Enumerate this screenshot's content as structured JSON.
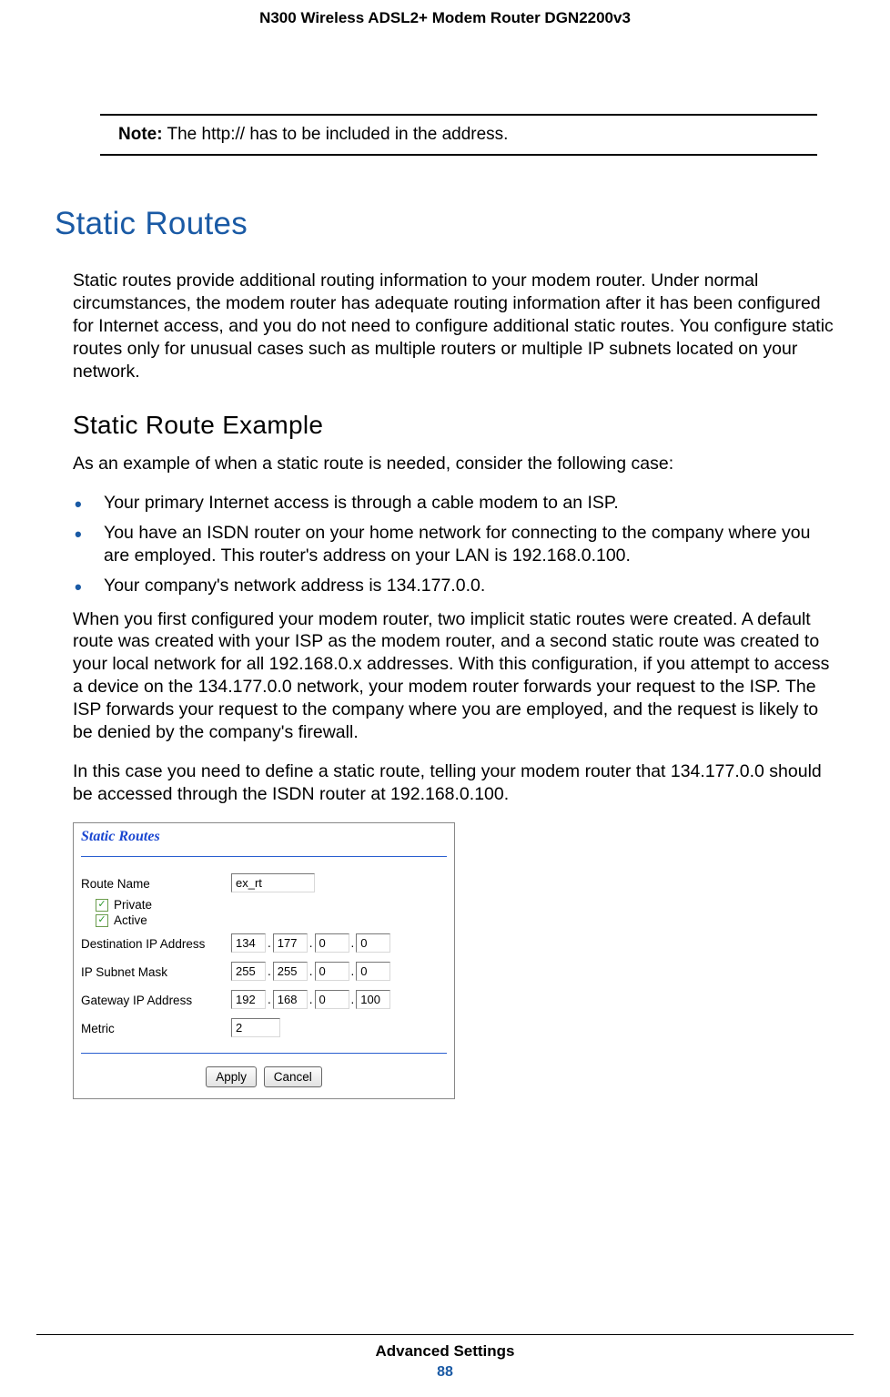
{
  "header": {
    "title": "N300 Wireless ADSL2+ Modem Router DGN2200v3"
  },
  "note": {
    "label": "Note:",
    "text": "  The http:// has to be included in the address."
  },
  "section": {
    "h1": "Static Routes",
    "p1": "Static routes provide additional routing information to your modem router. Under normal circumstances, the modem router has adequate routing information after it has been configured for Internet access, and you do not need to configure additional static routes. You configure static routes only for unusual cases such as multiple routers or multiple IP subnets located on your network.",
    "h2": "Static Route Example",
    "p2": "As an example of when a static route is needed, consider the following case:",
    "bullets": [
      "Your primary Internet access is through a cable modem to an ISP.",
      "You have an ISDN router on your home network for connecting to the company where you are employed. This router's address on your LAN is 192.168.0.100.",
      "Your company's network address is 134.177.0.0."
    ],
    "p3": "When you first configured your modem router, two implicit static routes were created. A default route was created with your ISP as the modem router, and a second static route was created to your local network for all 192.168.0.x addresses. With this configuration, if you attempt to access a device on the 134.177.0.0 network, your modem router forwards your request to the ISP. The ISP forwards your request to the company where you are employed, and the request is likely to be denied by the company's firewall.",
    "p4": "In this case you need to define a static route, telling your modem router that 134.177.0.0 should be accessed through the ISDN router at 192.168.0.100."
  },
  "figure": {
    "title": "Static Routes",
    "labels": {
      "route_name": "Route Name",
      "private": "Private",
      "active": "Active",
      "dest_ip": "Destination IP Address",
      "subnet": "IP Subnet Mask",
      "gateway": "Gateway IP Address",
      "metric": "Metric"
    },
    "values": {
      "route_name": "ex_rt",
      "private_checked": "✓",
      "active_checked": "✓",
      "dest_ip": [
        "134",
        "177",
        "0",
        "0"
      ],
      "subnet": [
        "255",
        "255",
        "0",
        "0"
      ],
      "gateway": [
        "192",
        "168",
        "0",
        "100"
      ],
      "metric": "2"
    },
    "buttons": {
      "apply": "Apply",
      "cancel": "Cancel"
    }
  },
  "footer": {
    "section": "Advanced Settings",
    "page": "88"
  }
}
